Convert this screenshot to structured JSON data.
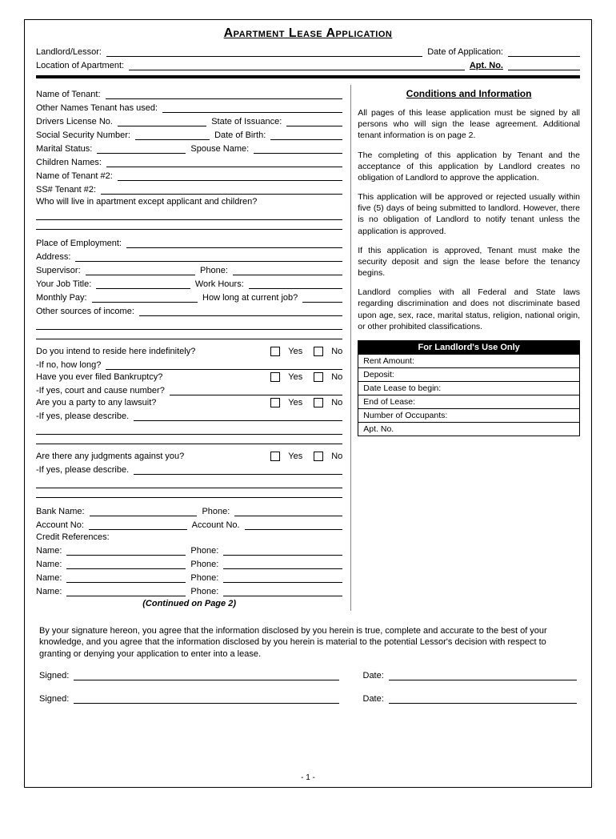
{
  "title": "Apartment Lease Application",
  "hdr": {
    "landlord": "Landlord/Lessor:",
    "dateapp": "Date of Application:",
    "loc": "Location of Apartment:",
    "aptno": "Apt. No."
  },
  "f": {
    "name": "Name of Tenant:",
    "othernames": "Other Names Tenant has used:",
    "dl": "Drivers License No.",
    "state": "State of Issuance:",
    "ssn": "Social Security Number:",
    "dob": "Date of Birth:",
    "marital": "Marital Status:",
    "spouse": "Spouse Name:",
    "children": "Children Names:",
    "t2name": "Name of Tenant #2:",
    "t2ss": "SS# Tenant #2:",
    "wholive": "Who will live in apartment except applicant and children?",
    "empl": "Place of Employment:",
    "addr": "Address:",
    "sup": "Supervisor:",
    "phone": "Phone:",
    "jobtitle": "Your Job Title:",
    "hours": "Work Hours:",
    "pay": "Monthly Pay:",
    "howlong": "How long at current job?",
    "othersrc": "Other sources of income:",
    "reside": "Do you intend to reside here indefinitely?",
    "ifno": "-If no, how long?",
    "bank": "Have you ever filed Bankruptcy?",
    "ifyes": "-If yes, court and cause number?",
    "lawsuit": "Are you a party to any lawsuit?",
    "ifyes2": "-If yes, please describe.",
    "judg": "Are there any judgments against you?",
    "bankname": "Bank Name:",
    "acct": "Account No:",
    "acct2": "Account No.",
    "credref": "Credit References:",
    "refname": "Name:",
    "yes": "Yes",
    "no": "No"
  },
  "cont": "(Continued on Page 2)",
  "cond": {
    "title": "Conditions and Information",
    "p1": "All pages of this lease application must be signed by all persons who will sign the lease agreement. Additional tenant information is on page 2.",
    "p2": "The completing of this application by Tenant and the acceptance of this application by Landlord creates no obligation of Landlord to approve the application.",
    "p3": "This application will be approved or rejected usually within five (5) days of being submitted to landlord.  However, there is no obligation of Landlord to notify tenant unless the application is approved.",
    "p4": "If this application is approved, Tenant must make the security deposit and sign the lease before the tenancy begins.",
    "p5": "Landlord complies with all Federal and State laws regarding discrimination and does not discriminate based upon age, sex, race, marital status, religion, national origin, or other prohibited classifications."
  },
  "lluse": {
    "hd": "For Landlord's Use Only",
    "rent": "Rent Amount:",
    "dep": "Deposit:",
    "begin": "Date Lease to begin:",
    "end": "End of Lease:",
    "occ": "Number of Occupants:",
    "apt": "Apt. No."
  },
  "agree": "By your signature hereon, you agree that the information disclosed by you herein is true, complete and accurate to the best of your knowledge, and you agree that the information disclosed by you herein is material to the potential Lessor's decision with respect to granting or denying your application to enter into a lease.",
  "sig": {
    "signed": "Signed:",
    "date": "Date:"
  },
  "page": "- 1 -"
}
